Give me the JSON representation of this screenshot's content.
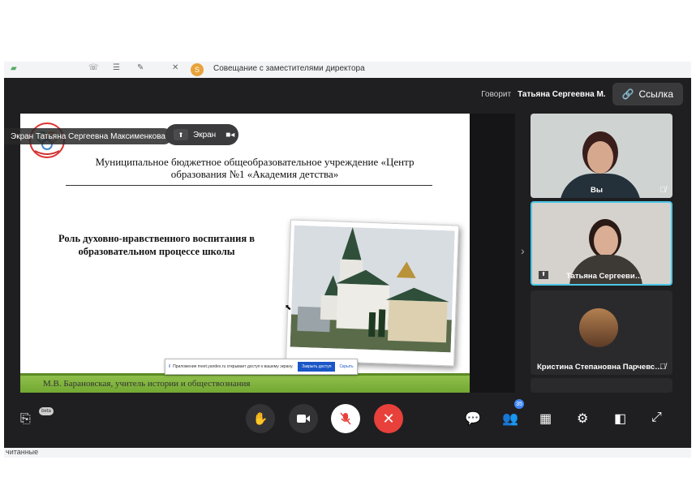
{
  "app": {
    "meeting_title": "Совещание с заместителями директора",
    "meeting_avatar_letter": "S",
    "bottom_left_text": "читанные"
  },
  "header": {
    "speaker_label": "Говорит",
    "speaker_name": "Татьяна Сергеевна М.",
    "link_button_label": "Ссылка"
  },
  "presentation": {
    "presenter_name": "Экран Татьяна Сергеевна Максименкова",
    "screen_pill_label": "Экран",
    "org_title": "Муниципальное бюджетное общеобразовательное учреждение «Центр образования №1 «Академия детства»",
    "topic": "Роль духовно-нравственного воспитания в образовательном процессе школы",
    "author": "М.В. Барановская, учитель истории и обществознания",
    "share_banner_text": "Приложение meet.yandex.ru открывает доступ к вашему экрану.",
    "share_banner_stop": "Закрыть доступ",
    "share_banner_hide": "Скрыть"
  },
  "participants": [
    {
      "name": "Вы",
      "muted": true
    },
    {
      "name": "Татьяна Сергееви…",
      "muted": false
    },
    {
      "name": "Кристина Степановна Парчевс…",
      "muted": true
    }
  ],
  "controls": {
    "participants_count": "35",
    "captions_badge": "beta"
  },
  "colors": {
    "call_bg": "#1f1f21",
    "hangup": "#e8403b",
    "active_tile_border": "#4cc7e6",
    "slide_footer": "#7cb342"
  }
}
